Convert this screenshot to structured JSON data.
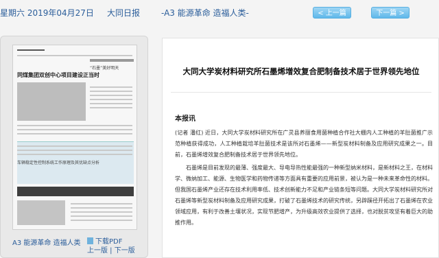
{
  "header": {
    "date": "星期六 2019年04月27日",
    "paper": "大同日报",
    "edition": "-A3 能源革命 造福人类-",
    "prev_label": "< 上一篇",
    "next_label": "下一篇 >"
  },
  "sidebar": {
    "thumbnail_headline_1": "同煤集团双创中心项目建设正当时",
    "thumbnail_headline_2": "“石墨”美好明天",
    "thumbnail_headline_3": "车辆稳定性控制系统工作原理及其优缺点分析",
    "page_caption": "A3 能源革命 造福人类",
    "pdf_label": "下载PDF",
    "page_nav": "上一版 | 下一版"
  },
  "article": {
    "title": "大同大学炭材料研究所石墨烯增效复合肥制备技术居于世界领先地位",
    "reporter": "本报讯",
    "paragraphs": [
      "(记者 潘红) 近日，大同大学炭材料研究所在广灵县养丽食用菌种植合作社大棚内人工种植的羊肚菌推广示范种植获得成功，人工种植栽培羊肚菌技术是该所对石墨烯——新型炭材料制备及应用研究成果之一。目前，石墨烯增效复合肥制备技术居于世界领先地位。",
      "石墨烯是目前发现的最薄、强度最大、导电导热性能最强的一种新型纳米材料，是新材料之王，在材料学、微纳加工、能源、生物医学和药物传递等方面具有重要的应用前景，被认为是一种未来革命性的材料。但我国石墨烯产业还存在技术利用率低、技术创新能力不足和产业链条短等问题。大同大学炭材料研究所对石墨烯等新型炭材料制备及应用研究成果，打破了石墨烯技术的研究传统，另辟蹊径开拓出了石墨烯在农业领域应用，有利于改善土壤状况，实现节肥增产，为升级高效农业提供了选择，也对脱贫攻坚有着巨大的助推作用。"
    ]
  },
  "colors": {
    "link_blue": "#2a5d9a",
    "button_blue": "#5fb8ea"
  }
}
